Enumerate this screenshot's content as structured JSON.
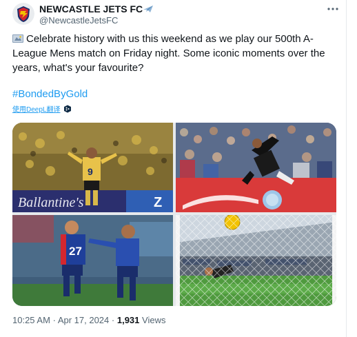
{
  "tweet": {
    "author": {
      "display_name": "NEWCASTLE JETS FC",
      "handle": "@NewcastleJetsFC",
      "badge_icon": "airplane-icon"
    },
    "menu_icon": "more-horizontal-icon",
    "text": "Celebrate history with us this weekend as we play our 500th A-League Mens match on Friday night. Some iconic moments over the years, what's your favourite?",
    "leading_emoji": "flag-icon",
    "hashtag": "#BondedByGold",
    "translate": {
      "label": "使用DeepL翻译",
      "icon": "translate-logo-icon"
    },
    "media": {
      "photo1": {
        "shirt_number": "9",
        "banner_left": "Ballantine's",
        "banner_right": "Z"
      },
      "photo3": {
        "shirt_number": "27"
      }
    },
    "meta": {
      "time": "10:25 AM",
      "separator": "·",
      "date": "Apr 17, 2024",
      "views_count": "1,931",
      "views_label": "Views"
    }
  },
  "colors": {
    "accent": "#1d9bf0",
    "secondary_text": "#536471",
    "jets_gold": "#f2c200",
    "jets_navy": "#1a2d6b",
    "jets_red": "#d3272f"
  }
}
